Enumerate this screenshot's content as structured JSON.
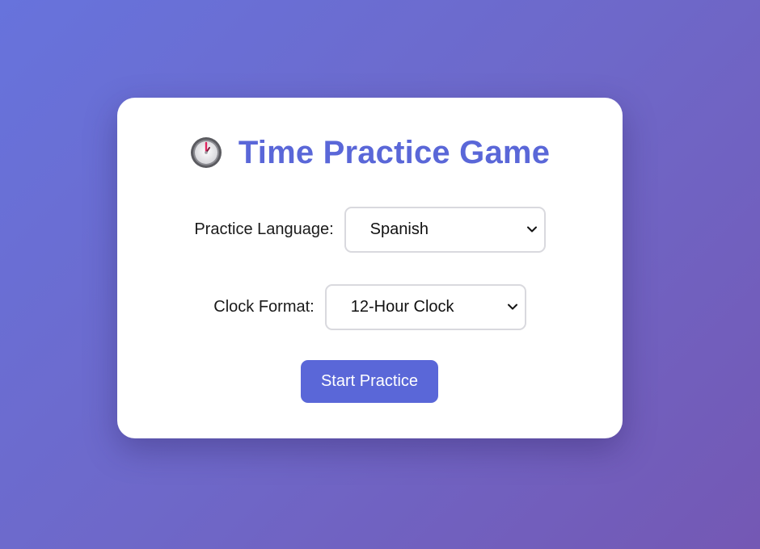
{
  "app": {
    "title": "Time Practice Game",
    "title_icon": "clock-icon"
  },
  "settings": {
    "language": {
      "label": "Practice Language:",
      "selected": "Spanish"
    },
    "clock_format": {
      "label": "Clock Format:",
      "selected": "12-Hour Clock"
    }
  },
  "actions": {
    "start_label": "Start Practice"
  },
  "colors": {
    "accent": "#5a67d8",
    "background_start": "#6773dc",
    "background_end": "#7458b4",
    "card": "#ffffff"
  }
}
